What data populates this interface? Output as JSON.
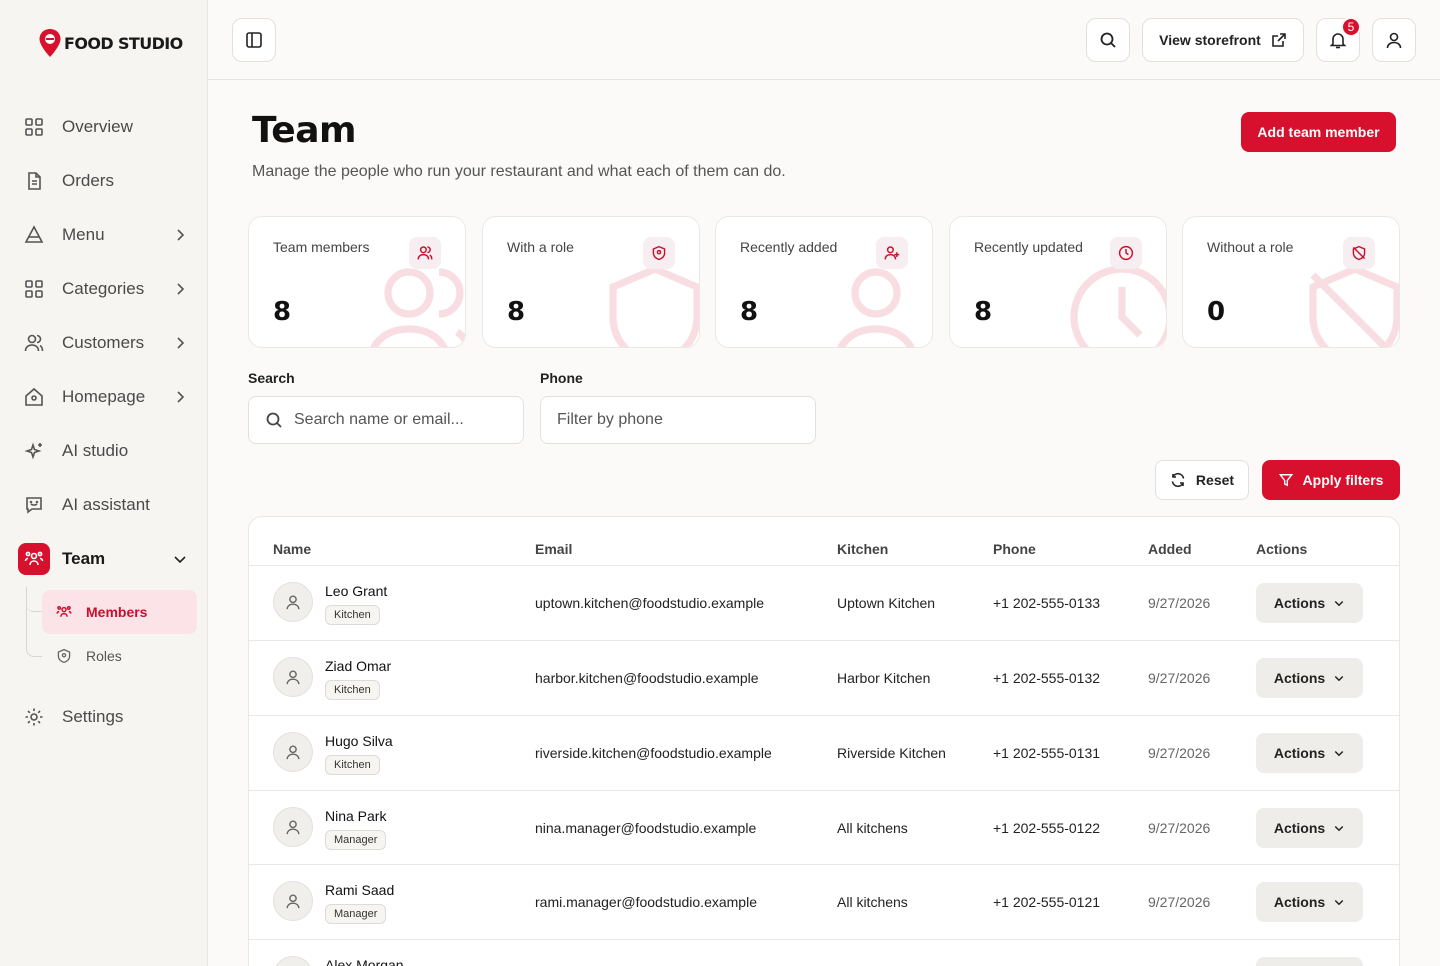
{
  "brand": {
    "name": "FOOD STUDIO"
  },
  "sidebar": {
    "items": [
      {
        "label": "Overview",
        "icon": "grid-icon"
      },
      {
        "label": "Orders",
        "icon": "document-icon"
      },
      {
        "label": "Menu",
        "icon": "triangle-icon"
      },
      {
        "label": "Categories",
        "icon": "grid-icon"
      },
      {
        "label": "Customers",
        "icon": "users-icon"
      },
      {
        "label": "Homepage",
        "icon": "home-icon"
      },
      {
        "label": "AI studio",
        "icon": "sparkles-icon"
      },
      {
        "label": "AI assistant",
        "icon": "chat-icon"
      },
      {
        "label": "Team",
        "icon": "team-icon"
      },
      {
        "label": "Settings",
        "icon": "gear-icon"
      }
    ],
    "team_sub": [
      {
        "label": "Members",
        "active": true
      },
      {
        "label": "Roles",
        "active": false
      }
    ]
  },
  "topbar": {
    "storefront_label": "View storefront",
    "notification_count": "5"
  },
  "header": {
    "title": "Team",
    "subtitle": "Manage the people who run your restaurant and what each of them can do.",
    "add_button": "Add team member"
  },
  "stats": [
    {
      "label": "Team members",
      "value": "8",
      "icon": "users-icon"
    },
    {
      "label": "With a role",
      "value": "8",
      "icon": "shield-icon"
    },
    {
      "label": "Recently added",
      "value": "8",
      "icon": "user-plus-icon"
    },
    {
      "label": "Recently updated",
      "value": "8",
      "icon": "clock-icon"
    },
    {
      "label": "Without a role",
      "value": "0",
      "icon": "shield-off-icon"
    }
  ],
  "filters": {
    "search_label": "Search",
    "search_placeholder": "Search name or email...",
    "phone_label": "Phone",
    "phone_placeholder": "Filter by phone",
    "reset_label": "Reset",
    "apply_label": "Apply filters"
  },
  "table": {
    "columns": [
      "Name",
      "Email",
      "Kitchen",
      "Phone",
      "Added",
      "Actions"
    ],
    "action_label": "Actions",
    "rows": [
      {
        "name": "Leo Grant",
        "role": "Kitchen",
        "email": "uptown.kitchen@foodstudio.example",
        "kitchen": "Uptown Kitchen",
        "phone": "+1 202-555-0133",
        "added": "9/27/2026"
      },
      {
        "name": "Ziad Omar",
        "role": "Kitchen",
        "email": "harbor.kitchen@foodstudio.example",
        "kitchen": "Harbor Kitchen",
        "phone": "+1 202-555-0132",
        "added": "9/27/2026"
      },
      {
        "name": "Hugo Silva",
        "role": "Kitchen",
        "email": "riverside.kitchen@foodstudio.example",
        "kitchen": "Riverside Kitchen",
        "phone": "+1 202-555-0131",
        "added": "9/27/2026"
      },
      {
        "name": "Nina Park",
        "role": "Manager",
        "email": "nina.manager@foodstudio.example",
        "kitchen": "All kitchens",
        "phone": "+1 202-555-0122",
        "added": "9/27/2026"
      },
      {
        "name": "Rami Saad",
        "role": "Manager",
        "email": "rami.manager@foodstudio.example",
        "kitchen": "All kitchens",
        "phone": "+1 202-555-0121",
        "added": "9/27/2026"
      },
      {
        "name": "Alex Morgan",
        "role": "",
        "email": "",
        "kitchen": "",
        "phone": "",
        "added": ""
      }
    ]
  },
  "colors": {
    "accent": "#d7102e",
    "accent_soft": "#fbe3e7"
  }
}
